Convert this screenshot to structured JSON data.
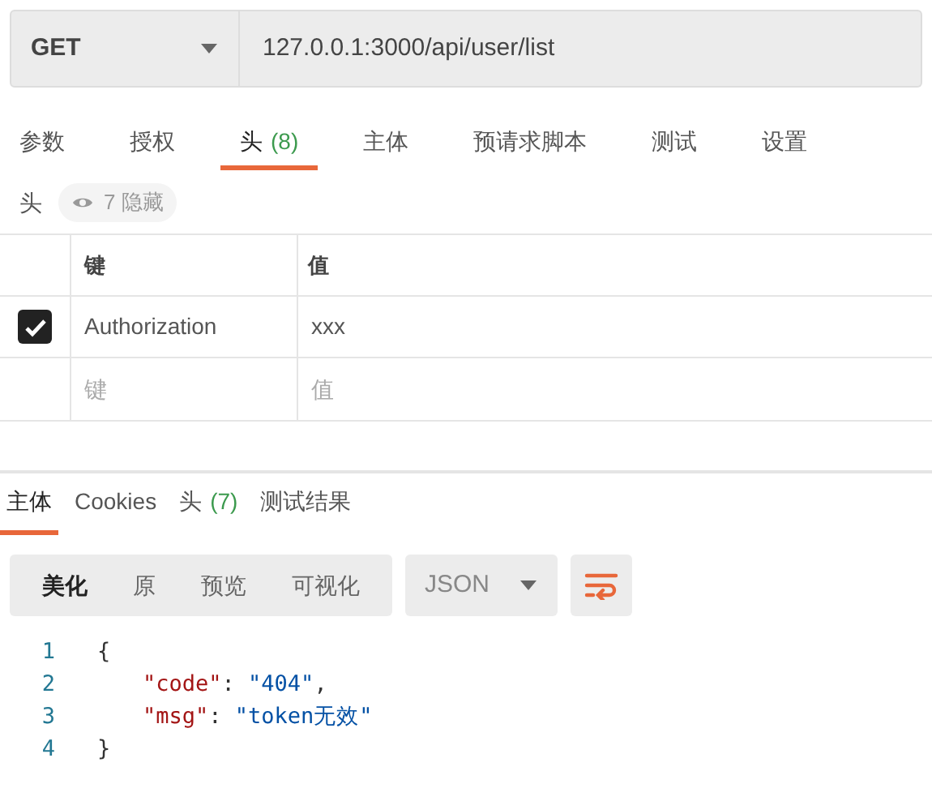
{
  "request": {
    "method": "GET",
    "url": "127.0.0.1:3000/api/user/list"
  },
  "request_tabs": [
    {
      "label": "参数",
      "selected": false
    },
    {
      "label": "授权",
      "selected": false
    },
    {
      "label": "头",
      "count": "(8)",
      "selected": true
    },
    {
      "label": "主体",
      "selected": false
    },
    {
      "label": "预请求脚本",
      "selected": false
    },
    {
      "label": "测试",
      "selected": false
    },
    {
      "label": "设置",
      "selected": false
    }
  ],
  "headers_bar": {
    "title": "头",
    "hidden_toggle": "7 隐藏"
  },
  "headers_table": {
    "columns": [
      "键",
      "值"
    ],
    "rows": [
      {
        "key": "Authorization",
        "value": "xxx",
        "checked": true
      }
    ],
    "new_row": {
      "key_placeholder": "键",
      "value_placeholder": "值"
    }
  },
  "response_tabs": [
    {
      "label": "主体",
      "selected": true
    },
    {
      "label": "Cookies",
      "selected": false
    },
    {
      "label": "头",
      "count": "(7)",
      "selected": false
    },
    {
      "label": "测试结果",
      "selected": false
    }
  ],
  "view_modes": [
    {
      "label": "美化",
      "selected": true
    },
    {
      "label": "原",
      "selected": false
    },
    {
      "label": "预览",
      "selected": false
    },
    {
      "label": "可视化",
      "selected": false
    }
  ],
  "format": "JSON",
  "code_lines": [
    {
      "number": "1",
      "indented": false,
      "tokens": [
        {
          "kind": "punct",
          "text": "{"
        }
      ]
    },
    {
      "number": "2",
      "indented": true,
      "tokens": [
        {
          "kind": "key",
          "text": "\"code\""
        },
        {
          "kind": "punct",
          "text": ": "
        },
        {
          "kind": "string",
          "text": "\"404\""
        },
        {
          "kind": "punct",
          "text": ","
        }
      ]
    },
    {
      "number": "3",
      "indented": true,
      "tokens": [
        {
          "kind": "key",
          "text": "\"msg\""
        },
        {
          "kind": "punct",
          "text": ": "
        },
        {
          "kind": "string",
          "text": "\"token无效\""
        }
      ]
    },
    {
      "number": "4",
      "indented": false,
      "tokens": [
        {
          "kind": "punct",
          "text": "}"
        }
      ]
    }
  ]
}
